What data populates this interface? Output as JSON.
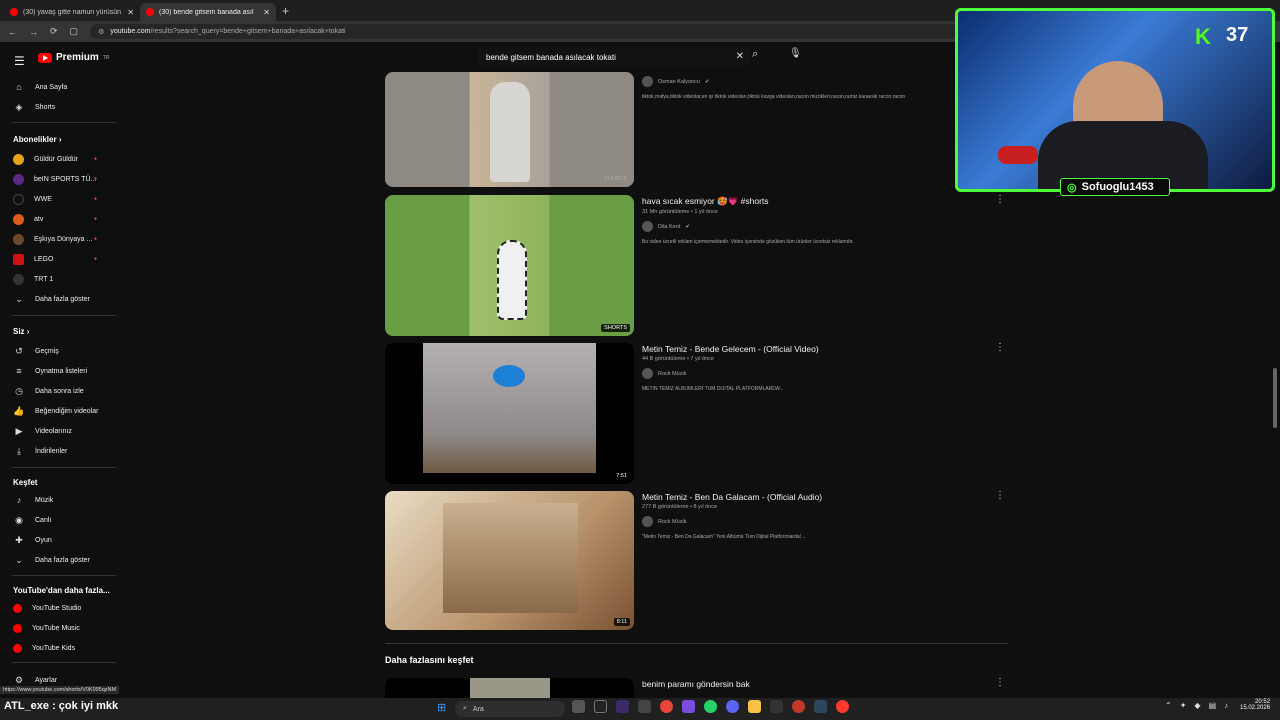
{
  "browser": {
    "tabs": [
      {
        "title": "(30) yavaş gitte namun yürüsün"
      },
      {
        "title": "(30) bende gitsem banada asıl"
      }
    ],
    "url_host": "youtube.com",
    "url_rest": "/results?search_query=bende+gitsem+banada+asılacak+tokati"
  },
  "sidebar": {
    "brand": "Premium",
    "main": [
      {
        "label": "Ana Sayfa",
        "icon": "home-icon"
      },
      {
        "label": "Shorts",
        "icon": "shorts-icon"
      }
    ],
    "subs_title": "Abonelikler",
    "subs": [
      {
        "label": "Güldür Güldür",
        "color": "#e7a21c"
      },
      {
        "label": "beIN SPORTS TÜ...",
        "color": "#5b2a86"
      },
      {
        "label": "WWE",
        "color": "#111111"
      },
      {
        "label": "atv",
        "color": "#e05a1b"
      },
      {
        "label": "Eşkıya Dünyaya ...",
        "color": "#6a4a2a"
      },
      {
        "label": "LEGO",
        "color": "#d01012"
      },
      {
        "label": "TRT 1",
        "color": "#333333"
      }
    ],
    "more": "Daha fazla göster",
    "you_title": "Siz",
    "you": [
      {
        "label": "Geçmiş",
        "icon": "history-icon"
      },
      {
        "label": "Oynatma listeleri",
        "icon": "playlist-icon"
      },
      {
        "label": "Daha sonra izle",
        "icon": "clock-icon"
      },
      {
        "label": "Beğendiğim videolar",
        "icon": "like-icon"
      },
      {
        "label": "Videolarınız",
        "icon": "video-icon"
      },
      {
        "label": "İndirilenler",
        "icon": "download-icon"
      }
    ],
    "explore_title": "Keşfet",
    "explore": [
      {
        "label": "Müzik",
        "icon": "music-icon"
      },
      {
        "label": "Canlı",
        "icon": "live-icon"
      },
      {
        "label": "Oyun",
        "icon": "game-icon"
      }
    ],
    "more2": "Daha fazla göster",
    "yt_more_title": "YouTube'dan daha fazla...",
    "yt_more": [
      {
        "label": "YouTube Studio"
      },
      {
        "label": "YouTube Music"
      },
      {
        "label": "YouTube Kids"
      }
    ],
    "settings": "Ayarlar"
  },
  "search": {
    "value": "bende gitsem banada asılacak tokati"
  },
  "results": [
    {
      "channel": "Osman Kalyoncu",
      "desc": "tiktok,mafya,tiktok videolar,en iyi tiktok videoları,tiktok kavga videoları,racon müzikleri,racon,ramiz karaeski racon,racon",
      "badge": "SHORTS"
    },
    {
      "title": "hava sıcak esmiyor 🥵💗 #shorts",
      "meta": "31 Mn görüntüleme • 1 yıl önce",
      "channel": "Dila Kent",
      "desc": "Bu video ücretli reklam içermemektedir. Video içersinde gözüken tüm ürünler ücretsiz reklamdır.",
      "badge": "SHORTS"
    },
    {
      "title": "Metin Temiz - Bende Gelecem - (Official Video)",
      "meta": "44 B görüntüleme • 7 yıl önce",
      "channel": "Rock Müzik",
      "desc": "METİN TEMİZ ALBÜMLERİ TÜM DİJİTAL PLATFORMLARDA!..",
      "badge": "7:51"
    },
    {
      "title": "Metin Temiz - Ben Da Galacam - (Official Audio)",
      "meta": "277 B görüntüleme • 8 yıl önce",
      "channel": "Rock Müzik",
      "desc": "\"Metin Temiz - Ben Da Galacam\" Yeni Albümü Tüm Dijital Platformlarda!...",
      "badge": "8:11"
    }
  ],
  "heading": "Daha fazlasını keşfet",
  "next": {
    "title": "benim paramı göndersin bak"
  },
  "overlay": {
    "handle": "Sofuoglu1453",
    "k": "K",
    "num": "37"
  },
  "status_url": "https://www.youtube.com/shorts/V0K095qzNM",
  "chat": "ATL_exe : çok iyi mkk",
  "taskbar": {
    "search": "Ara",
    "time": "20:52",
    "date": "15.02.2026"
  }
}
